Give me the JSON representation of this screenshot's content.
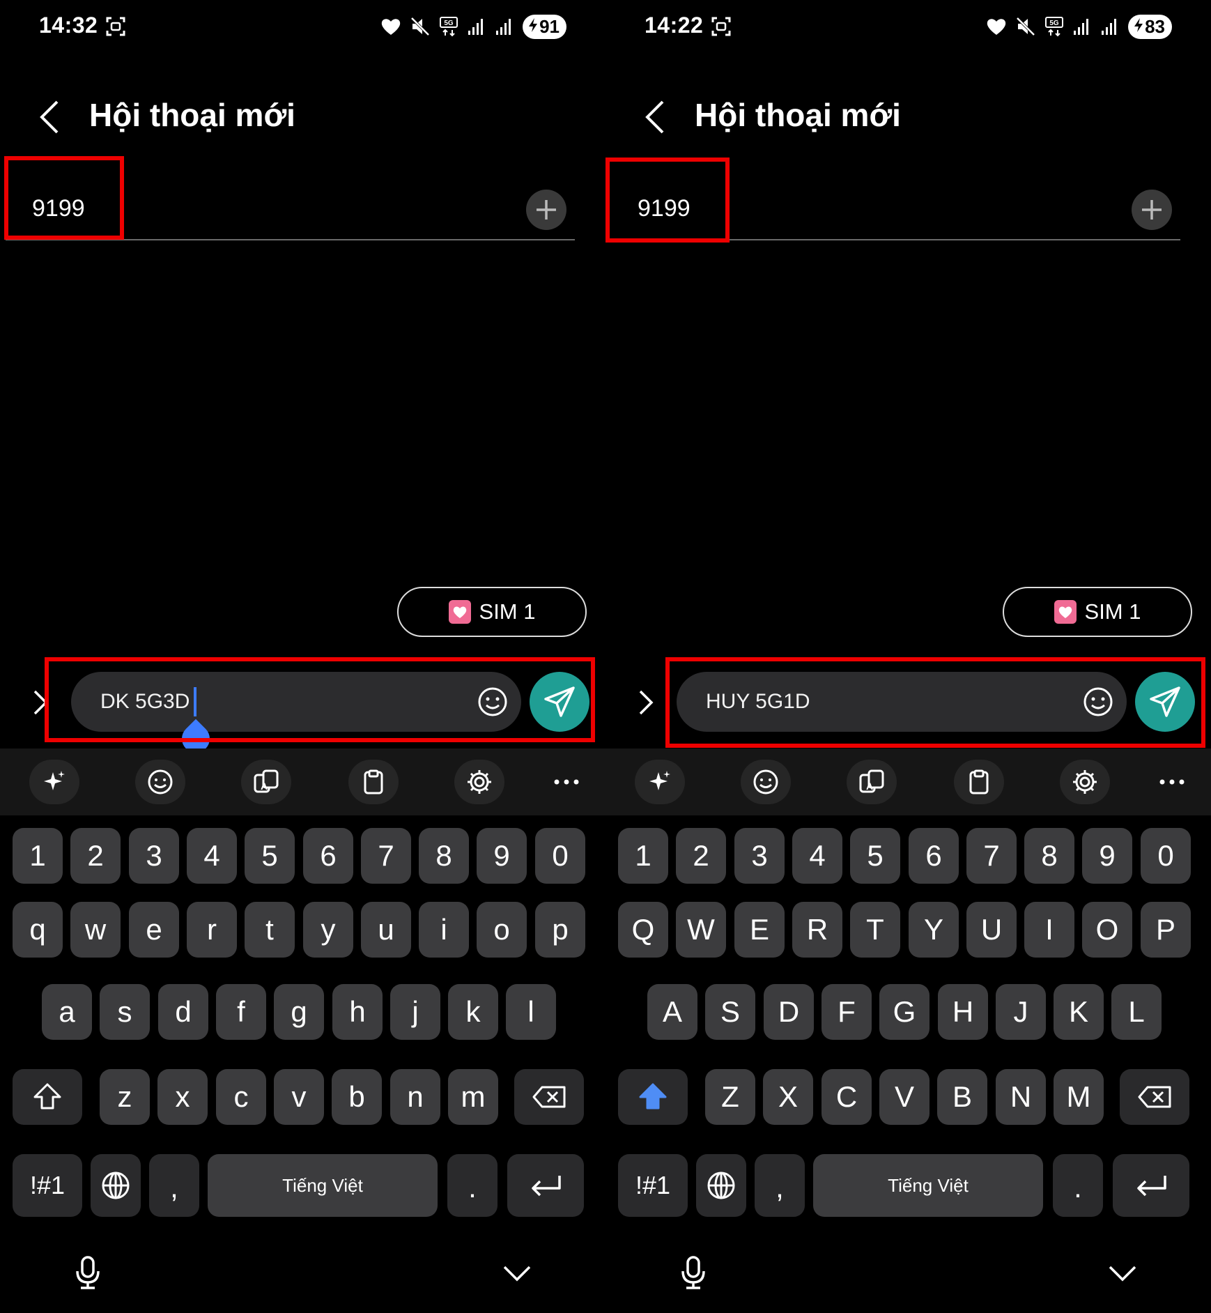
{
  "panels": [
    {
      "status": {
        "time": "14:32",
        "battery": "91"
      },
      "header": {
        "title": "Hội thoại mới"
      },
      "recipient": {
        "value": "9199"
      },
      "sim": {
        "label": "SIM 1"
      },
      "compose": {
        "text": "DK 5G3D"
      },
      "keyboard": {
        "number_row": [
          "1",
          "2",
          "3",
          "4",
          "5",
          "6",
          "7",
          "8",
          "9",
          "0"
        ],
        "row1": [
          "q",
          "w",
          "e",
          "r",
          "t",
          "y",
          "u",
          "i",
          "o",
          "p"
        ],
        "row2": [
          "a",
          "s",
          "d",
          "f",
          "g",
          "h",
          "j",
          "k",
          "l"
        ],
        "row3": [
          "z",
          "x",
          "c",
          "v",
          "b",
          "n",
          "m"
        ],
        "symbols_label": "!#1",
        "comma_label": ",",
        "space_label": "Tiếng Việt",
        "period_label": ".",
        "shift_active": false
      }
    },
    {
      "status": {
        "time": "14:22",
        "battery": "83"
      },
      "header": {
        "title": "Hội thoại mới"
      },
      "recipient": {
        "value": "9199"
      },
      "sim": {
        "label": "SIM 1"
      },
      "compose": {
        "text": "HUY 5G1D"
      },
      "keyboard": {
        "number_row": [
          "1",
          "2",
          "3",
          "4",
          "5",
          "6",
          "7",
          "8",
          "9",
          "0"
        ],
        "row1": [
          "Q",
          "W",
          "E",
          "R",
          "T",
          "Y",
          "U",
          "I",
          "O",
          "P"
        ],
        "row2": [
          "A",
          "S",
          "D",
          "F",
          "G",
          "H",
          "J",
          "K",
          "L"
        ],
        "row3": [
          "Z",
          "X",
          "C",
          "V",
          "B",
          "N",
          "M"
        ],
        "symbols_label": "!#1",
        "comma_label": ",",
        "space_label": "Tiếng Việt",
        "period_label": ".",
        "shift_active": true
      }
    }
  ],
  "colors": {
    "highlight": "#ee0000",
    "send": "#1f9e94",
    "cursor": "#3d7cff",
    "shift_active": "#4f8df5",
    "sim_icon": "#f06b94"
  },
  "icons": {
    "status": [
      "screenshot-icon",
      "heart-icon",
      "mute-icon",
      "5g-icon",
      "signal-icon",
      "battery-icon"
    ],
    "header": [
      "back-icon"
    ],
    "recipient": [
      "add-icon"
    ],
    "compose": [
      "expand-icon",
      "emoji-icon",
      "send-icon"
    ],
    "toolbar": [
      "sparkle-icon",
      "emoji-icon",
      "translate-icon",
      "clipboard-icon",
      "settings-icon",
      "more-icon"
    ],
    "keyboard": [
      "shift-icon",
      "backspace-icon",
      "globe-icon",
      "enter-icon"
    ],
    "nav": [
      "microphone-icon",
      "chevron-down-icon"
    ]
  }
}
